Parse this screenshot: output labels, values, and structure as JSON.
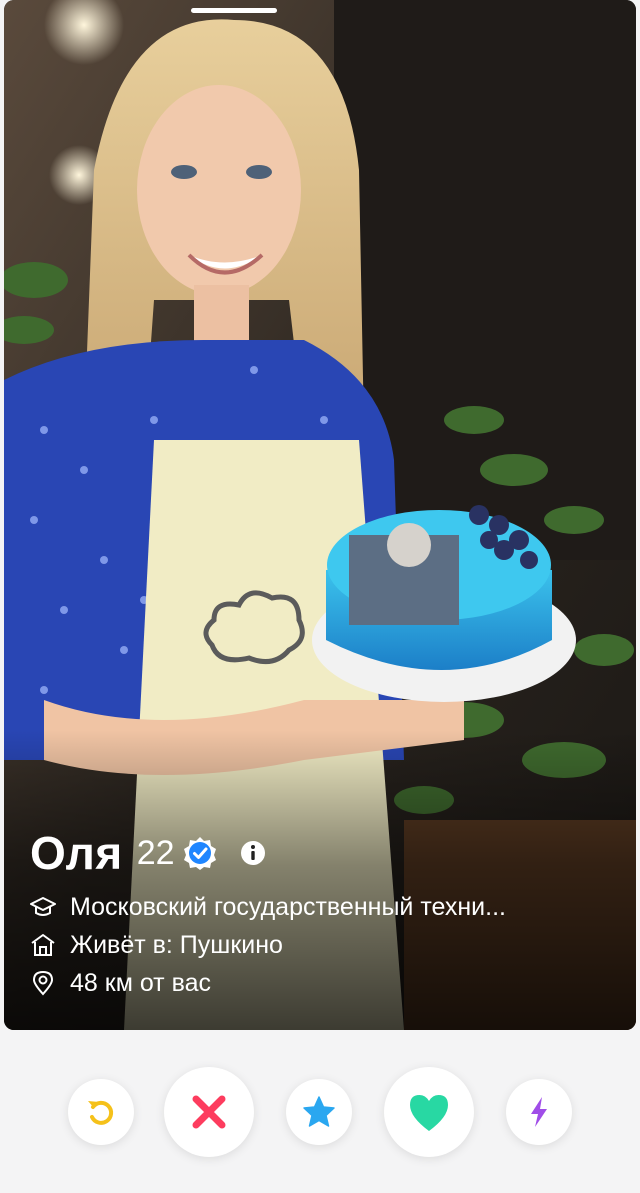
{
  "profile": {
    "name": "Оля",
    "age": "22",
    "details": {
      "school": "Московский государственный техни...",
      "lives_in": "Живёт в: Пушкино",
      "distance": "48 км от вас"
    }
  },
  "icons": {
    "verified": "verified-badge-icon",
    "info": "info-icon",
    "school": "graduation-cap-icon",
    "home": "home-icon",
    "location": "location-pin-icon",
    "rewind": "rewind-icon",
    "nope": "close-icon",
    "superlike": "star-icon",
    "like": "heart-icon",
    "boost": "lightning-icon"
  },
  "colors": {
    "rewind": "#f5c11a",
    "nope": "#fd3c5e",
    "superlike": "#2aa7f0",
    "like": "#28d8a3",
    "boost": "#a04de8",
    "verified": "#1f86ff"
  }
}
